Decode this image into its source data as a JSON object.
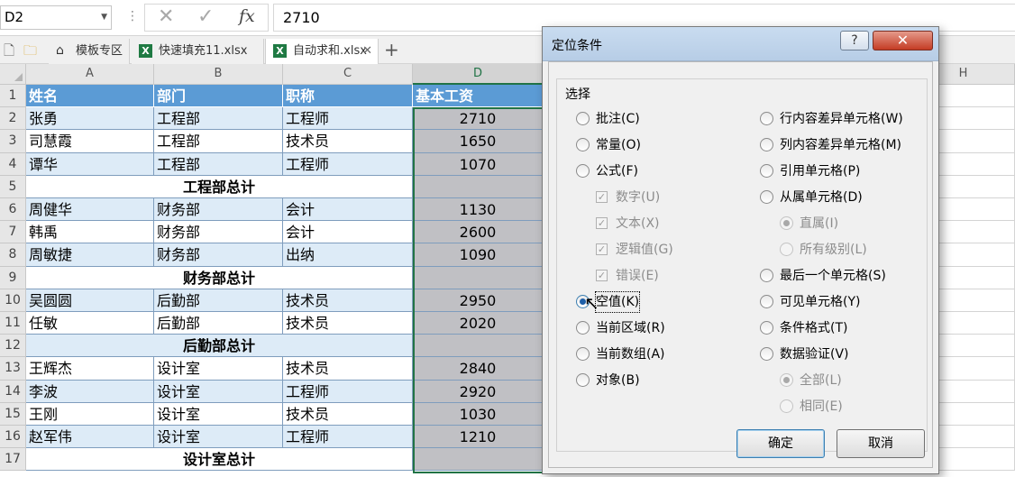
{
  "formula_bar": {
    "name_box": "D2",
    "cancel_glyph": "✕",
    "enter_glyph": "✓",
    "fx_label": "fx",
    "value": "2710"
  },
  "tabs": [
    {
      "label": "模板专区",
      "icon": "home-icon"
    },
    {
      "label": "快速填充11.xlsx",
      "icon": "excel-file-icon"
    },
    {
      "label": "自动求和.xlsx",
      "icon": "excel-file-icon",
      "active": true
    }
  ],
  "columns": [
    "A",
    "B",
    "C",
    "D",
    "H"
  ],
  "rows": [
    "1",
    "2",
    "3",
    "4",
    "5",
    "6",
    "7",
    "8",
    "9",
    "10",
    "11",
    "12",
    "13",
    "14",
    "15",
    "16",
    "17"
  ],
  "table": {
    "headers": [
      "姓名",
      "部门",
      "职称",
      "基本工资"
    ],
    "data": [
      {
        "row": 2,
        "name": "张勇",
        "dept": "工程部",
        "title": "工程师",
        "salary": "2710"
      },
      {
        "row": 3,
        "name": "司慧霞",
        "dept": "工程部",
        "title": "技术员",
        "salary": "1650"
      },
      {
        "row": 4,
        "name": "谭华",
        "dept": "工程部",
        "title": "工程师",
        "salary": "1070"
      },
      {
        "row": 5,
        "subtotal": "工程部总计"
      },
      {
        "row": 6,
        "name": "周健华",
        "dept": "财务部",
        "title": "会计",
        "salary": "1130"
      },
      {
        "row": 7,
        "name": "韩禹",
        "dept": "财务部",
        "title": "会计",
        "salary": "2600"
      },
      {
        "row": 8,
        "name": "周敏捷",
        "dept": "财务部",
        "title": "出纳",
        "salary": "1090"
      },
      {
        "row": 9,
        "subtotal": "财务部总计"
      },
      {
        "row": 10,
        "name": "吴圆圆",
        "dept": "后勤部",
        "title": "技术员",
        "salary": "2950"
      },
      {
        "row": 11,
        "name": "任敏",
        "dept": "后勤部",
        "title": "技术员",
        "salary": "2020"
      },
      {
        "row": 12,
        "subtotal": "后勤部总计"
      },
      {
        "row": 13,
        "name": "王辉杰",
        "dept": "设计室",
        "title": "技术员",
        "salary": "2840"
      },
      {
        "row": 14,
        "name": "李波",
        "dept": "设计室",
        "title": "工程师",
        "salary": "2920"
      },
      {
        "row": 15,
        "name": "王刚",
        "dept": "设计室",
        "title": "技术员",
        "salary": "1030"
      },
      {
        "row": 16,
        "name": "赵军伟",
        "dept": "设计室",
        "title": "工程师",
        "salary": "1210"
      },
      {
        "row": 17,
        "subtotal": "设计室总计"
      }
    ]
  },
  "dialog": {
    "title": "定位条件",
    "help_label": "?",
    "close_label": "✕",
    "group_label": "选择",
    "left_options": [
      {
        "label": "批注(C)",
        "type": "radio",
        "checked": false,
        "disabled": false
      },
      {
        "label": "常量(O)",
        "type": "radio",
        "checked": false,
        "disabled": false
      },
      {
        "label": "公式(F)",
        "type": "radio",
        "checked": false,
        "disabled": false
      },
      {
        "label": "数字(U)",
        "type": "check",
        "checked": true,
        "disabled": true
      },
      {
        "label": "文本(X)",
        "type": "check",
        "checked": true,
        "disabled": true
      },
      {
        "label": "逻辑值(G)",
        "type": "check",
        "checked": true,
        "disabled": true
      },
      {
        "label": "错误(E)",
        "type": "check",
        "checked": true,
        "disabled": true
      },
      {
        "label": "空值(K)",
        "type": "radio",
        "checked": true,
        "disabled": false
      },
      {
        "label": "当前区域(R)",
        "type": "radio",
        "checked": false,
        "disabled": false
      },
      {
        "label": "当前数组(A)",
        "type": "radio",
        "checked": false,
        "disabled": false
      },
      {
        "label": "对象(B)",
        "type": "radio",
        "checked": false,
        "disabled": false
      }
    ],
    "right_options": [
      {
        "label": "行内容差异单元格(W)",
        "type": "radio",
        "checked": false,
        "disabled": false
      },
      {
        "label": "列内容差异单元格(M)",
        "type": "radio",
        "checked": false,
        "disabled": false
      },
      {
        "label": "引用单元格(P)",
        "type": "radio",
        "checked": false,
        "disabled": false
      },
      {
        "label": "从属单元格(D)",
        "type": "radio",
        "checked": false,
        "disabled": false
      },
      {
        "label": "直属(I)",
        "type": "radio",
        "checked": true,
        "disabled": true
      },
      {
        "label": "所有级别(L)",
        "type": "radio",
        "checked": false,
        "disabled": true
      },
      {
        "label": "最后一个单元格(S)",
        "type": "radio",
        "checked": false,
        "disabled": false
      },
      {
        "label": "可见单元格(Y)",
        "type": "radio",
        "checked": false,
        "disabled": false
      },
      {
        "label": "条件格式(T)",
        "type": "radio",
        "checked": false,
        "disabled": false
      },
      {
        "label": "数据验证(V)",
        "type": "radio",
        "checked": false,
        "disabled": false
      },
      {
        "label": "全部(L)",
        "type": "radio",
        "checked": true,
        "disabled": true
      },
      {
        "label": "相同(E)",
        "type": "radio",
        "checked": false,
        "disabled": true
      }
    ],
    "ok_label": "确定",
    "cancel_label": "取消"
  },
  "colors": {
    "header_fill": "#5b9bd5",
    "band_fill": "#ddebf7",
    "selected_fill": "#c0c0c4",
    "excel_green": "#217346"
  }
}
